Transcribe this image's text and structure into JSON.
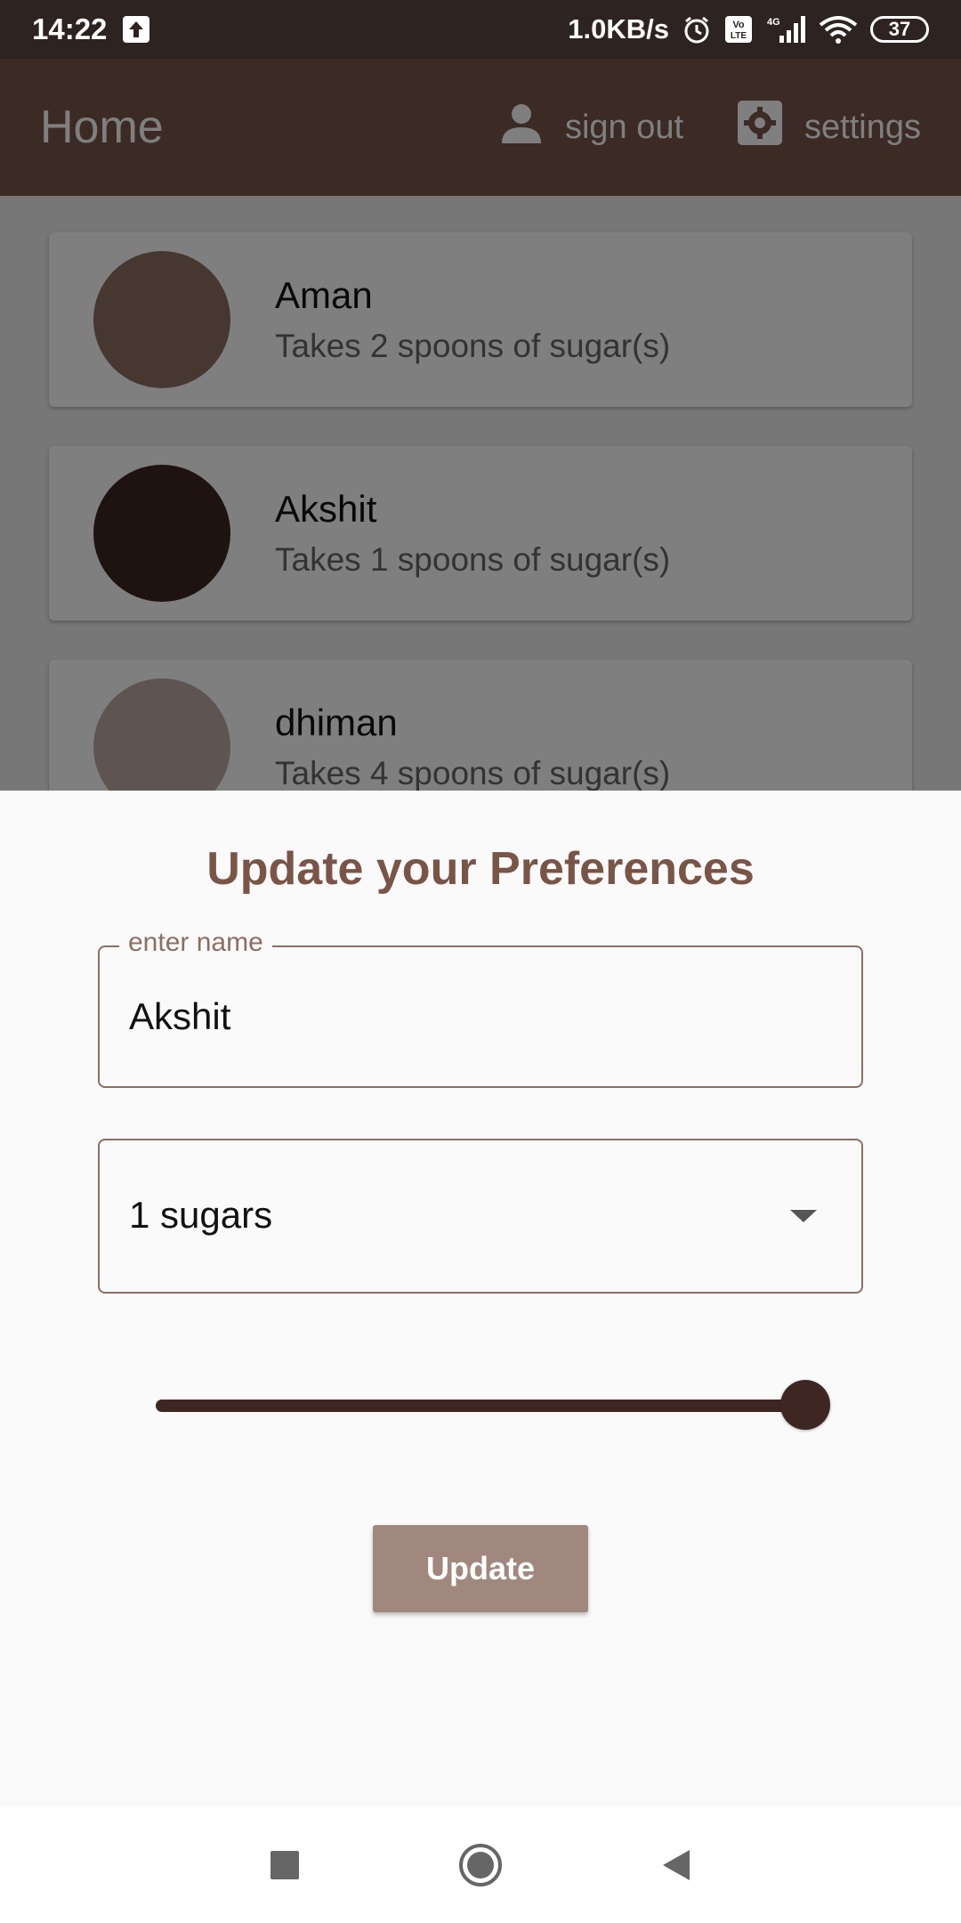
{
  "status_bar": {
    "time": "14:22",
    "net_speed": "1.0KB/s",
    "volte": "Vo\nLTE",
    "network": "4G",
    "battery": "37"
  },
  "appbar": {
    "title": "Home",
    "sign_out": "sign out",
    "settings": "settings"
  },
  "list": {
    "items": [
      {
        "name": "Aman",
        "subtitle": "Takes 2 spoons of sugar(s)",
        "color": "#8d6e63"
      },
      {
        "name": "Akshit",
        "subtitle": "Takes 1 spoons of sugar(s)",
        "color": "#3e2723"
      },
      {
        "name": "dhiman",
        "subtitle": "Takes 4 spoons of sugar(s)",
        "color": "#bcaaa4"
      }
    ]
  },
  "sheet": {
    "title": "Update your Preferences",
    "name_label": "enter name",
    "name_value": "Akshit",
    "sugars_value": "1 sugars",
    "strength_fraction": 1.0,
    "update_label": "Update"
  },
  "colors": {
    "primary": "#795548",
    "primary_dark": "#3e2723",
    "button": "#a1887f"
  }
}
